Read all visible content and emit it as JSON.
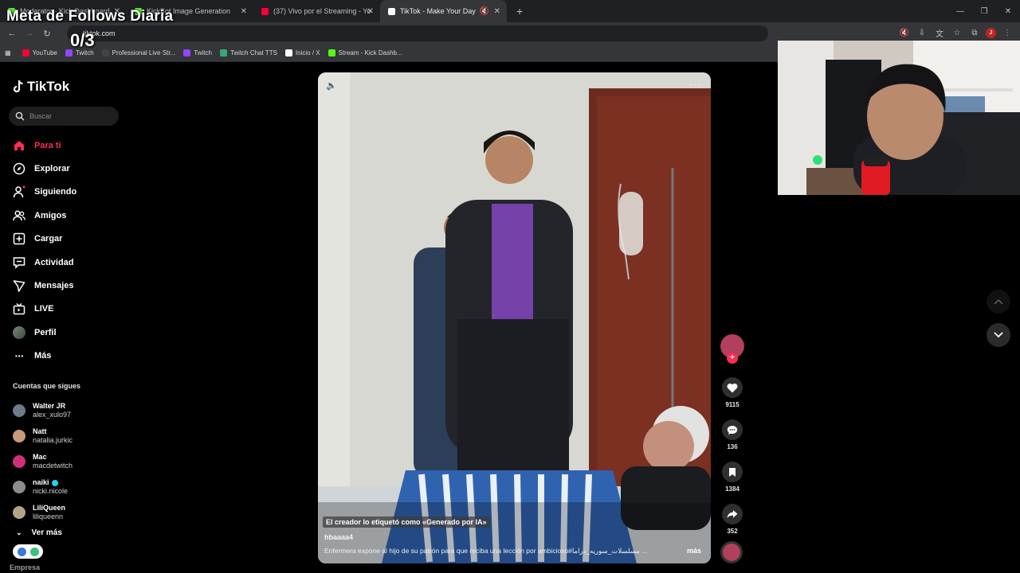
{
  "browser": {
    "tabs": [
      {
        "title": "Moderator - Kick Dashboard",
        "favicon_color": "#53fc18"
      },
      {
        "title": "KickBot Image Generation",
        "favicon_color": "#53fc18"
      },
      {
        "title": "(37) Vivo por el Streaming - Yo",
        "favicon_color": "#ff0033"
      },
      {
        "title": "TikTok - Make Your Day",
        "favicon_color": "#ffffff"
      }
    ],
    "url": "tiktok.com",
    "bookmarks": [
      {
        "label": "YouTube",
        "color": "#ff0033"
      },
      {
        "label": "Twitch",
        "color": "#9146ff"
      },
      {
        "label": "Professional Live Str...",
        "color": "#444444"
      },
      {
        "label": "Twitch",
        "color": "#9146ff"
      },
      {
        "label": "Twitch Chat TTS",
        "color": "#3aa675"
      },
      {
        "label": "Inicio / X",
        "color": "#ffffff"
      },
      {
        "label": "Stream - Kick Dashb...",
        "color": "#53fc18"
      }
    ]
  },
  "overlay": {
    "title": "Meta de Follows Diaria",
    "count": "0/3"
  },
  "sidebar": {
    "logo": "TikTok",
    "search_placeholder": "Buscar",
    "nav": [
      {
        "label": "Para ti",
        "icon": "home-icon"
      },
      {
        "label": "Explorar",
        "icon": "compass-icon"
      },
      {
        "label": "Siguiendo",
        "icon": "following-icon"
      },
      {
        "label": "Amigos",
        "icon": "friends-icon"
      },
      {
        "label": "Cargar",
        "icon": "upload-icon"
      },
      {
        "label": "Actividad",
        "icon": "activity-icon"
      },
      {
        "label": "Mensajes",
        "icon": "messages-icon"
      },
      {
        "label": "LIVE",
        "icon": "live-icon"
      },
      {
        "label": "Perfil",
        "icon": "profile-icon"
      },
      {
        "label": "Más",
        "icon": "more-icon"
      }
    ],
    "following_header": "Cuentas que sigues",
    "following": [
      {
        "name": "Walter JR",
        "handle": "alex_xulo97",
        "color": "#6f7a8a"
      },
      {
        "name": "Natt",
        "handle": "natalia.jurkic",
        "color": "#c99a7a"
      },
      {
        "name": "Mac",
        "handle": "macdetwitch",
        "color": "#d0307a"
      },
      {
        "name": "naiki",
        "handle": "nicki.nicole",
        "color": "#8c8c8c",
        "verified": true
      },
      {
        "name": "LiliQueen",
        "handle": "liliqueenn",
        "color": "#b5a28a"
      }
    ],
    "see_more": "Ver más",
    "footer": "Empresa"
  },
  "video": {
    "ai_label": "El creador lo etiquetó como «Generado por IA»",
    "username": "hbaaaa4",
    "description": "Enfermera expone al hijo de su patrón para que reciba una lección por ambicioso#مسلسلات_سوريه_دراما ...",
    "more": "más"
  },
  "actions": {
    "likes": "9115",
    "comments": "136",
    "saves": "1384",
    "shares": "352"
  }
}
